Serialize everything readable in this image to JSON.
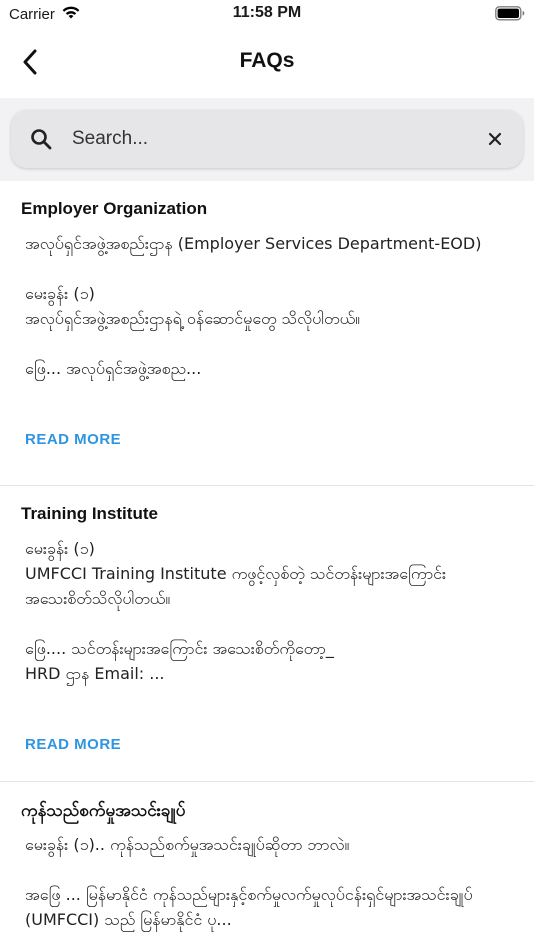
{
  "status_bar": {
    "carrier": "Carrier",
    "time": "11:58 PM"
  },
  "header": {
    "title": "FAQs"
  },
  "search": {
    "placeholder": "Search..."
  },
  "colors": {
    "accent": "#2f95e0",
    "background": "#f2f2f4",
    "card": "#ffffff"
  },
  "faqs": [
    {
      "title": "Employer Organization",
      "body": "အလုပ်ရှင်အဖွဲ့အစည်းဌာန (Employer Services Department-EOD)\n\nမေးခွန်း (၁)\nအလုပ်ရှင်အဖွဲ့အစည်းဌာနရဲ့ ဝန်ဆောင်မှုတွေ သိလိုပါတယ်။\n\nဖြေ...  အလုပ်ရှင်အဖွဲ့အစည...",
      "read_more": "READ MORE"
    },
    {
      "title": "Training Institute",
      "body": "မေးခွန်း (၁)\nUMFCCI Training Institute ကဖွင့်လှစ်တဲ့ သင်တန်းများအကြောင်း အသေးစိတ်သိလိုပါတယ်။\n\nဖြေ.... သင်တန်းများအကြောင်း အသေးစိတ်ကိုတော့_\nHRD ဌာန Email: ...",
      "read_more": "READ MORE"
    },
    {
      "title": "ကုန်သည်စက်မှုအသင်းချုပ်",
      "body": "မေးခွန်း (၁).. ကုန်သည်စက်မှုအသင်းချုပ်ဆိုတာ ဘာလဲ။\n\nအဖြေ ... မြန်မာနိုင်ငံ ကုန်သည်များနှင့်စက်မှုလက်မှုလုပ်ငန်းရှင်များအသင်းချုပ် (UMFCCI) သည် မြန်မာနိုင်ငံ ပု..."
    }
  ]
}
